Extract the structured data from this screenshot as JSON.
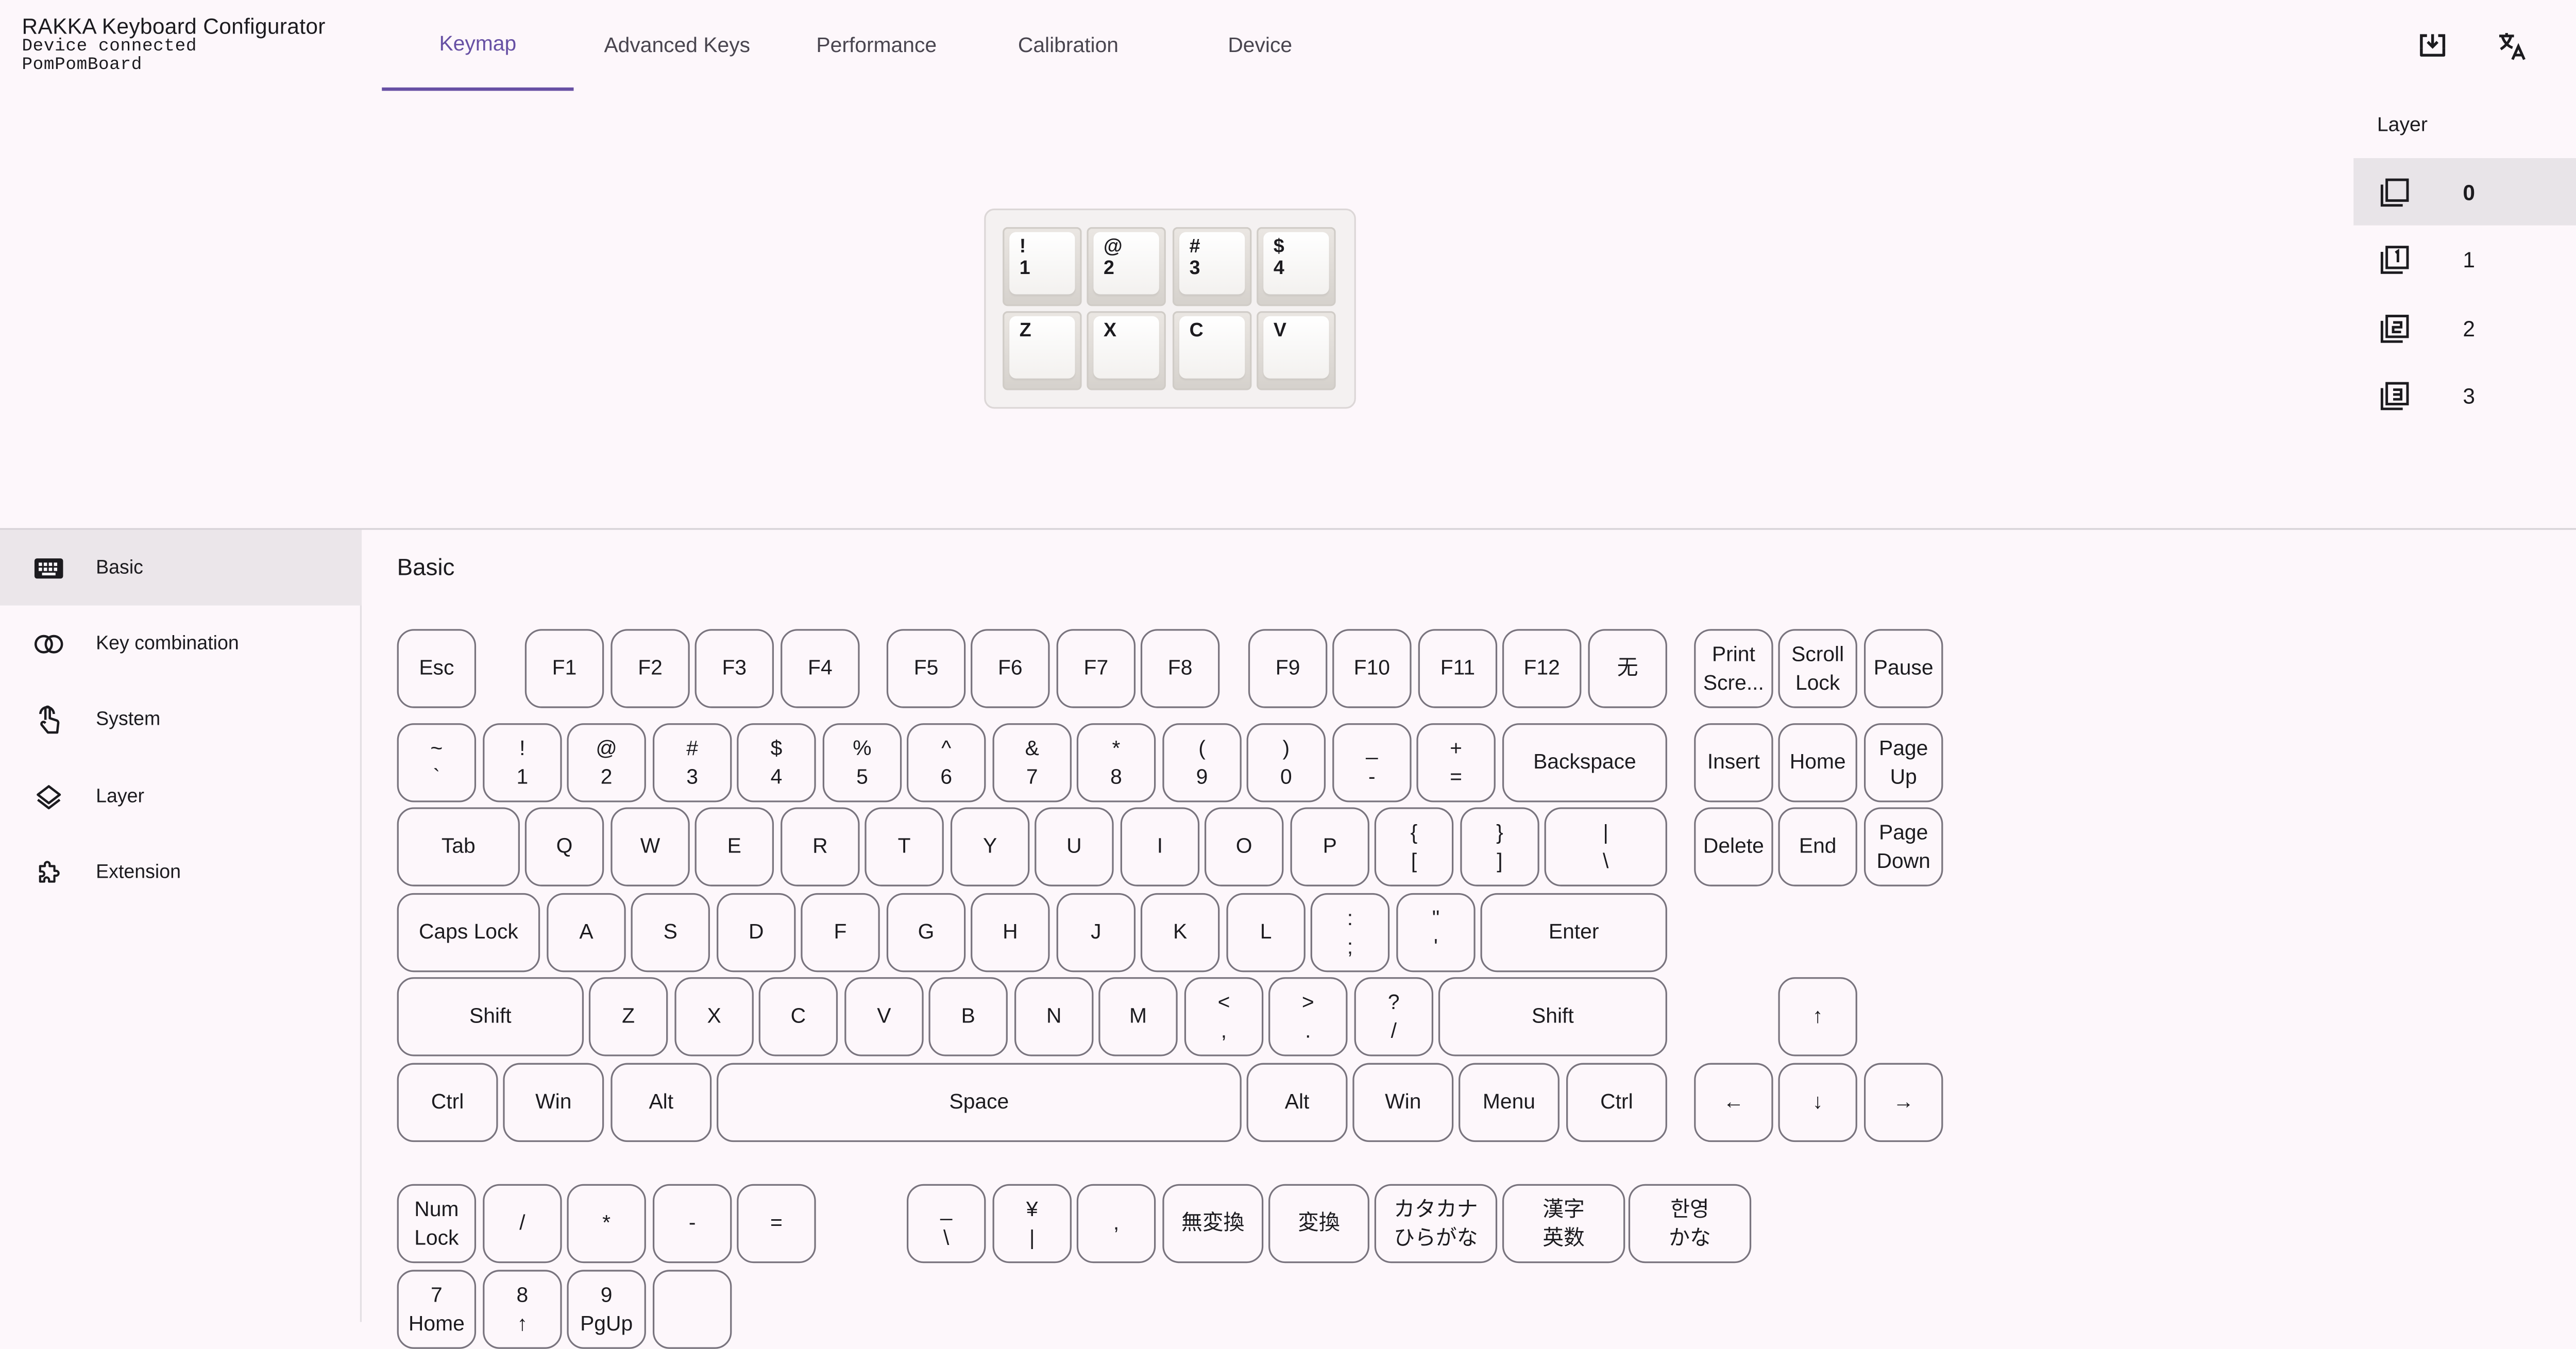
{
  "app": {
    "title": "RAKKA Keyboard Configurator",
    "status": "Device connected",
    "device_name": "PomPomBoard"
  },
  "tabs": [
    {
      "label": "Keymap",
      "active": true
    },
    {
      "label": "Advanced Keys",
      "active": false
    },
    {
      "label": "Performance",
      "active": false
    },
    {
      "label": "Calibration",
      "active": false
    },
    {
      "label": "Device",
      "active": false
    }
  ],
  "header_icons": [
    "download-icon",
    "translate-icon",
    "dark-mode-icon"
  ],
  "layers": {
    "title": "Layer",
    "items": [
      {
        "label": "0",
        "icon": "layer-0-icon",
        "active": true
      },
      {
        "label": "1",
        "icon": "layer-1-icon",
        "active": false
      },
      {
        "label": "2",
        "icon": "layer-2-icon",
        "active": false
      },
      {
        "label": "3",
        "icon": "layer-3-icon",
        "active": false
      }
    ]
  },
  "preview_keys": [
    "!\n1",
    "@\n2",
    "#\n3",
    "$\n4",
    "Z",
    "X",
    "C",
    "V"
  ],
  "nav": {
    "items": [
      {
        "label": "Basic",
        "icon": "keyboard-icon",
        "active": true
      },
      {
        "label": "Key combination",
        "icon": "key-combination-icon",
        "active": false
      },
      {
        "label": "System",
        "icon": "touch-icon",
        "active": false
      },
      {
        "label": "Layer",
        "icon": "layers-icon",
        "active": false
      },
      {
        "label": "Extension",
        "icon": "extension-icon",
        "active": false
      }
    ]
  },
  "section": {
    "title": "Basic"
  },
  "keys": {
    "fn_row": [
      "Esc",
      "F1",
      "F2",
      "F3",
      "F4",
      "F5",
      "F6",
      "F7",
      "F8",
      "F9",
      "F10",
      "F11",
      "F12",
      "无"
    ],
    "number_row": [
      "~\n`",
      "!\n1",
      "@\n2",
      "#\n3",
      "$\n4",
      "%\n5",
      "^\n6",
      "&\n7",
      "*\n8",
      "(\n9",
      ")\n0",
      "_\n-",
      "+\n=",
      "Backspace"
    ],
    "tab_row": [
      "Tab",
      "Q",
      "W",
      "E",
      "R",
      "T",
      "Y",
      "U",
      "I",
      "O",
      "P",
      "{\n[",
      "}\n]",
      "|\n\\"
    ],
    "caps_row": [
      "Caps Lock",
      "A",
      "S",
      "D",
      "F",
      "G",
      "H",
      "J",
      "K",
      "L",
      ":\n;",
      "\"\n'",
      "Enter"
    ],
    "shift_row": [
      "Shift",
      "Z",
      "X",
      "C",
      "V",
      "B",
      "N",
      "M",
      "<\n,",
      ">\n.",
      "?\n/",
      "Shift"
    ],
    "ctrl_row": [
      "Ctrl",
      "Win",
      "Alt",
      "Space",
      "Alt",
      "Win",
      "Menu",
      "Ctrl"
    ],
    "nav_top": [
      "Print\nScre...",
      "Scroll\nLock",
      "Pause"
    ],
    "nav_mid1": [
      "Insert",
      "Home",
      "Page\nUp"
    ],
    "nav_mid2": [
      "Delete",
      "End",
      "Page\nDown"
    ],
    "arrows": [
      "↑",
      "←",
      "↓",
      "→"
    ],
    "numpad_row1": [
      "Num\nLock",
      "/",
      "*",
      "-",
      "="
    ],
    "numpad_row2": [
      "7\nHome",
      "8\n↑",
      "9\nPgUp",
      ""
    ],
    "intl": [
      "_\n\\",
      "¥\n|",
      ",",
      "無変換",
      "変換",
      "カタカナ\nひらがな",
      "漢字\n英数",
      "한영\nかな"
    ]
  }
}
